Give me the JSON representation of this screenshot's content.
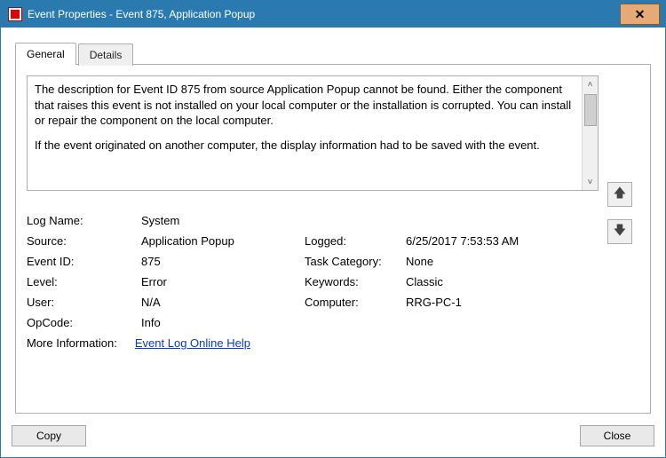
{
  "window": {
    "title": "Event Properties - Event 875, Application Popup"
  },
  "tabs": {
    "general": "General",
    "details": "Details"
  },
  "description": {
    "para1": "The description for Event ID 875 from source Application Popup cannot be found. Either the component that raises this event is not installed on your local computer or the installation is corrupted. You can install or repair the component on the local computer.",
    "para2": "If the event originated on another computer, the display information had to be saved with the event."
  },
  "labels": {
    "logName": "Log Name:",
    "source": "Source:",
    "eventId": "Event ID:",
    "level": "Level:",
    "user": "User:",
    "opcode": "OpCode:",
    "moreInfo": "More Information:",
    "logged": "Logged:",
    "taskCategory": "Task Category:",
    "keywords": "Keywords:",
    "computer": "Computer:"
  },
  "values": {
    "logName": "System",
    "source": "Application Popup",
    "eventId": "875",
    "level": "Error",
    "user": "N/A",
    "opcode": "Info",
    "logged": "6/25/2017 7:53:53 AM",
    "taskCategory": "None",
    "keywords": "Classic",
    "computer": "RRG-PC-1"
  },
  "link": {
    "onlineHelp": "Event Log Online Help"
  },
  "buttons": {
    "copy": "Copy",
    "close": "Close"
  }
}
